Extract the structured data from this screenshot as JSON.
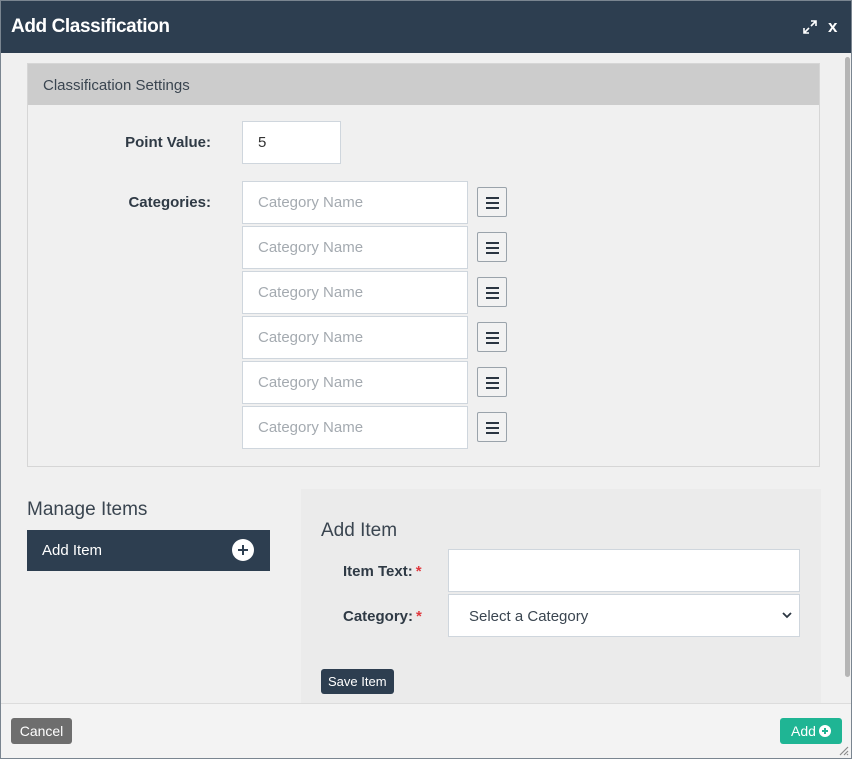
{
  "window": {
    "title": "Add Classification",
    "close_label": "x"
  },
  "settings": {
    "header": "Classification Settings",
    "point_value_label": "Point Value:",
    "point_value": "5",
    "categories_label": "Categories:",
    "category_placeholder": "Category Name",
    "categories": [
      "",
      "",
      "",
      "",
      "",
      ""
    ]
  },
  "manage": {
    "title": "Manage Items",
    "add_item_tab": "Add Item"
  },
  "add_item_form": {
    "heading": "Add Item",
    "item_text_label": "Item Text:",
    "required_mark": "*",
    "item_text_value": "",
    "category_label": "Category:",
    "category_selected": "Select a Category",
    "save_label": "Save Item"
  },
  "footer": {
    "cancel_label": "Cancel",
    "add_label": "Add"
  },
  "colors": {
    "titlebar": "#2d3e50",
    "add_button": "#1fb594",
    "cancel_button": "#6e6e6e",
    "required": "#e0383e"
  }
}
